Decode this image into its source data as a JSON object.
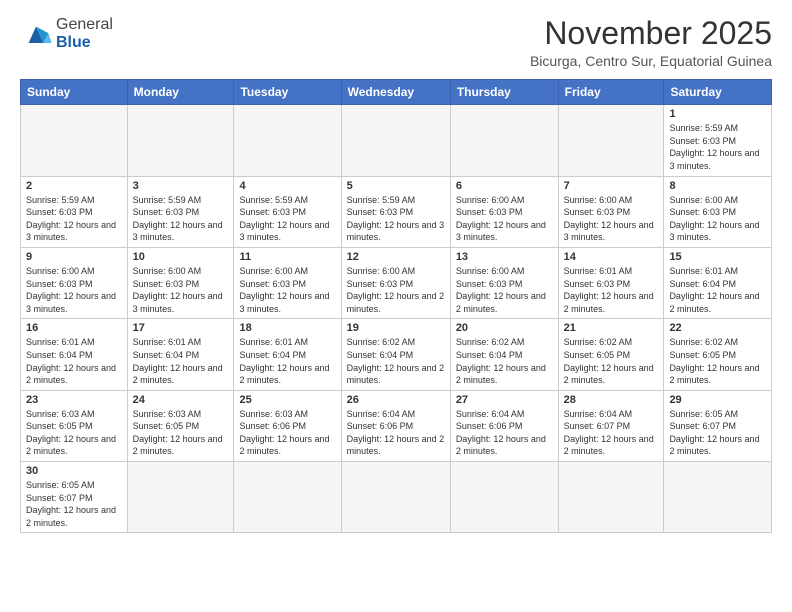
{
  "logo": {
    "line1": "General",
    "line2": "Blue"
  },
  "title": "November 2025",
  "subtitle": "Bicurga, Centro Sur, Equatorial Guinea",
  "weekdays": [
    "Sunday",
    "Monday",
    "Tuesday",
    "Wednesday",
    "Thursday",
    "Friday",
    "Saturday"
  ],
  "days": {
    "d1": {
      "num": "1",
      "info": "Sunrise: 5:59 AM\nSunset: 6:03 PM\nDaylight: 12 hours and 3 minutes."
    },
    "d2": {
      "num": "2",
      "info": "Sunrise: 5:59 AM\nSunset: 6:03 PM\nDaylight: 12 hours and 3 minutes."
    },
    "d3": {
      "num": "3",
      "info": "Sunrise: 5:59 AM\nSunset: 6:03 PM\nDaylight: 12 hours and 3 minutes."
    },
    "d4": {
      "num": "4",
      "info": "Sunrise: 5:59 AM\nSunset: 6:03 PM\nDaylight: 12 hours and 3 minutes."
    },
    "d5": {
      "num": "5",
      "info": "Sunrise: 5:59 AM\nSunset: 6:03 PM\nDaylight: 12 hours and 3 minutes."
    },
    "d6": {
      "num": "6",
      "info": "Sunrise: 6:00 AM\nSunset: 6:03 PM\nDaylight: 12 hours and 3 minutes."
    },
    "d7": {
      "num": "7",
      "info": "Sunrise: 6:00 AM\nSunset: 6:03 PM\nDaylight: 12 hours and 3 minutes."
    },
    "d8": {
      "num": "8",
      "info": "Sunrise: 6:00 AM\nSunset: 6:03 PM\nDaylight: 12 hours and 3 minutes."
    },
    "d9": {
      "num": "9",
      "info": "Sunrise: 6:00 AM\nSunset: 6:03 PM\nDaylight: 12 hours and 3 minutes."
    },
    "d10": {
      "num": "10",
      "info": "Sunrise: 6:00 AM\nSunset: 6:03 PM\nDaylight: 12 hours and 3 minutes."
    },
    "d11": {
      "num": "11",
      "info": "Sunrise: 6:00 AM\nSunset: 6:03 PM\nDaylight: 12 hours and 3 minutes."
    },
    "d12": {
      "num": "12",
      "info": "Sunrise: 6:00 AM\nSunset: 6:03 PM\nDaylight: 12 hours and 2 minutes."
    },
    "d13": {
      "num": "13",
      "info": "Sunrise: 6:00 AM\nSunset: 6:03 PM\nDaylight: 12 hours and 2 minutes."
    },
    "d14": {
      "num": "14",
      "info": "Sunrise: 6:01 AM\nSunset: 6:03 PM\nDaylight: 12 hours and 2 minutes."
    },
    "d15": {
      "num": "15",
      "info": "Sunrise: 6:01 AM\nSunset: 6:04 PM\nDaylight: 12 hours and 2 minutes."
    },
    "d16": {
      "num": "16",
      "info": "Sunrise: 6:01 AM\nSunset: 6:04 PM\nDaylight: 12 hours and 2 minutes."
    },
    "d17": {
      "num": "17",
      "info": "Sunrise: 6:01 AM\nSunset: 6:04 PM\nDaylight: 12 hours and 2 minutes."
    },
    "d18": {
      "num": "18",
      "info": "Sunrise: 6:01 AM\nSunset: 6:04 PM\nDaylight: 12 hours and 2 minutes."
    },
    "d19": {
      "num": "19",
      "info": "Sunrise: 6:02 AM\nSunset: 6:04 PM\nDaylight: 12 hours and 2 minutes."
    },
    "d20": {
      "num": "20",
      "info": "Sunrise: 6:02 AM\nSunset: 6:04 PM\nDaylight: 12 hours and 2 minutes."
    },
    "d21": {
      "num": "21",
      "info": "Sunrise: 6:02 AM\nSunset: 6:05 PM\nDaylight: 12 hours and 2 minutes."
    },
    "d22": {
      "num": "22",
      "info": "Sunrise: 6:02 AM\nSunset: 6:05 PM\nDaylight: 12 hours and 2 minutes."
    },
    "d23": {
      "num": "23",
      "info": "Sunrise: 6:03 AM\nSunset: 6:05 PM\nDaylight: 12 hours and 2 minutes."
    },
    "d24": {
      "num": "24",
      "info": "Sunrise: 6:03 AM\nSunset: 6:05 PM\nDaylight: 12 hours and 2 minutes."
    },
    "d25": {
      "num": "25",
      "info": "Sunrise: 6:03 AM\nSunset: 6:06 PM\nDaylight: 12 hours and 2 minutes."
    },
    "d26": {
      "num": "26",
      "info": "Sunrise: 6:04 AM\nSunset: 6:06 PM\nDaylight: 12 hours and 2 minutes."
    },
    "d27": {
      "num": "27",
      "info": "Sunrise: 6:04 AM\nSunset: 6:06 PM\nDaylight: 12 hours and 2 minutes."
    },
    "d28": {
      "num": "28",
      "info": "Sunrise: 6:04 AM\nSunset: 6:07 PM\nDaylight: 12 hours and 2 minutes."
    },
    "d29": {
      "num": "29",
      "info": "Sunrise: 6:05 AM\nSunset: 6:07 PM\nDaylight: 12 hours and 2 minutes."
    },
    "d30": {
      "num": "30",
      "info": "Sunrise: 6:05 AM\nSunset: 6:07 PM\nDaylight: 12 hours and 2 minutes."
    }
  }
}
